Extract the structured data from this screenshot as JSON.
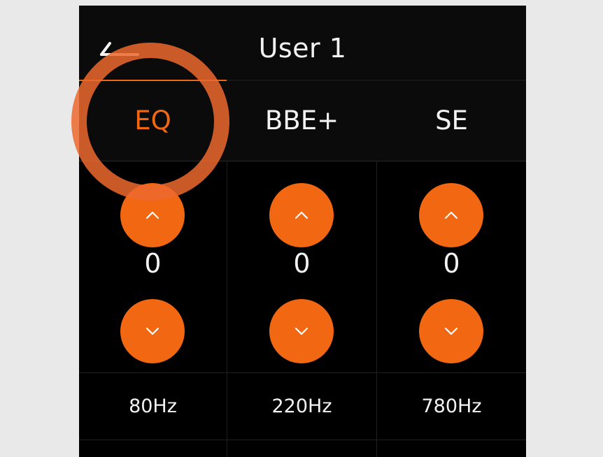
{
  "header": {
    "title": "User 1",
    "back_icon": "back-arrow-icon"
  },
  "tabs": [
    {
      "label": "EQ",
      "active": true
    },
    {
      "label": "BBE+",
      "active": false
    },
    {
      "label": "SE",
      "active": false
    }
  ],
  "bands": [
    {
      "value": "0",
      "freq": "80Hz",
      "up_icon": "chevron-up-icon",
      "down_icon": "chevron-down-icon"
    },
    {
      "value": "0",
      "freq": "220Hz",
      "up_icon": "chevron-up-icon",
      "down_icon": "chevron-down-icon"
    },
    {
      "value": "0",
      "freq": "780Hz",
      "up_icon": "chevron-up-icon",
      "down_icon": "chevron-down-icon"
    }
  ],
  "colors": {
    "accent": "#f26711",
    "highlight_ring": "#ec682e",
    "panel_bg": "#000000",
    "header_bg": "#0b0b0b",
    "text": "#f2f2f2",
    "outer_bg": "#e9e9e9"
  }
}
